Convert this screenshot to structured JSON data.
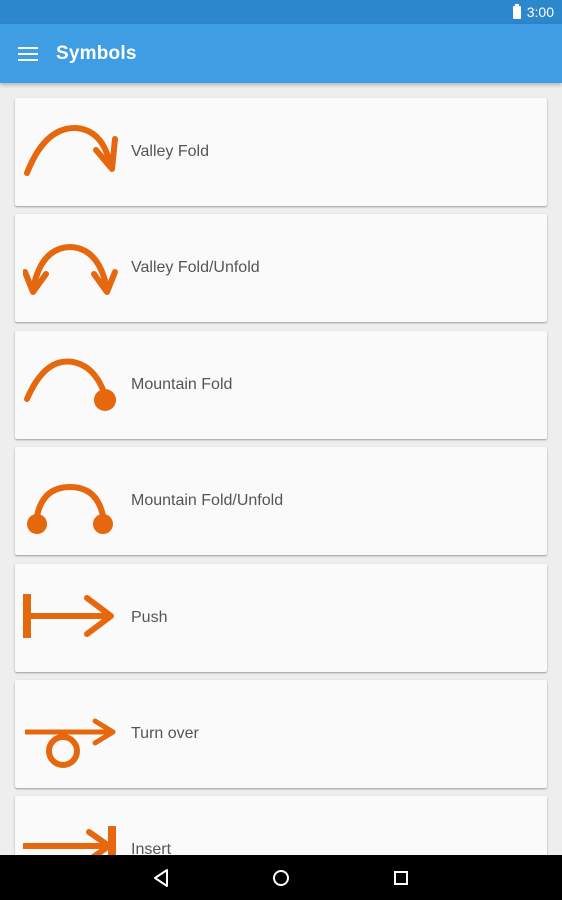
{
  "status_bar": {
    "time": "3:00",
    "battery_icon": "battery-full-icon"
  },
  "app_bar": {
    "title": "Symbols",
    "menu_icon": "hamburger-menu-icon",
    "color": "#3f9de3"
  },
  "symbol_color": "#e5680f",
  "symbols": [
    {
      "label": "Valley Fold",
      "icon": "valley-fold-icon"
    },
    {
      "label": "Valley Fold/Unfold",
      "icon": "valley-fold-unfold-icon"
    },
    {
      "label": "Mountain Fold",
      "icon": "mountain-fold-icon"
    },
    {
      "label": "Mountain Fold/Unfold",
      "icon": "mountain-fold-unfold-icon"
    },
    {
      "label": "Push",
      "icon": "push-icon"
    },
    {
      "label": "Turn over",
      "icon": "turn-over-icon"
    },
    {
      "label": "Insert",
      "icon": "insert-icon"
    }
  ],
  "nav_bar": {
    "back_icon": "back-triangle-icon",
    "home_icon": "home-circle-icon",
    "recents_icon": "recents-square-icon"
  }
}
